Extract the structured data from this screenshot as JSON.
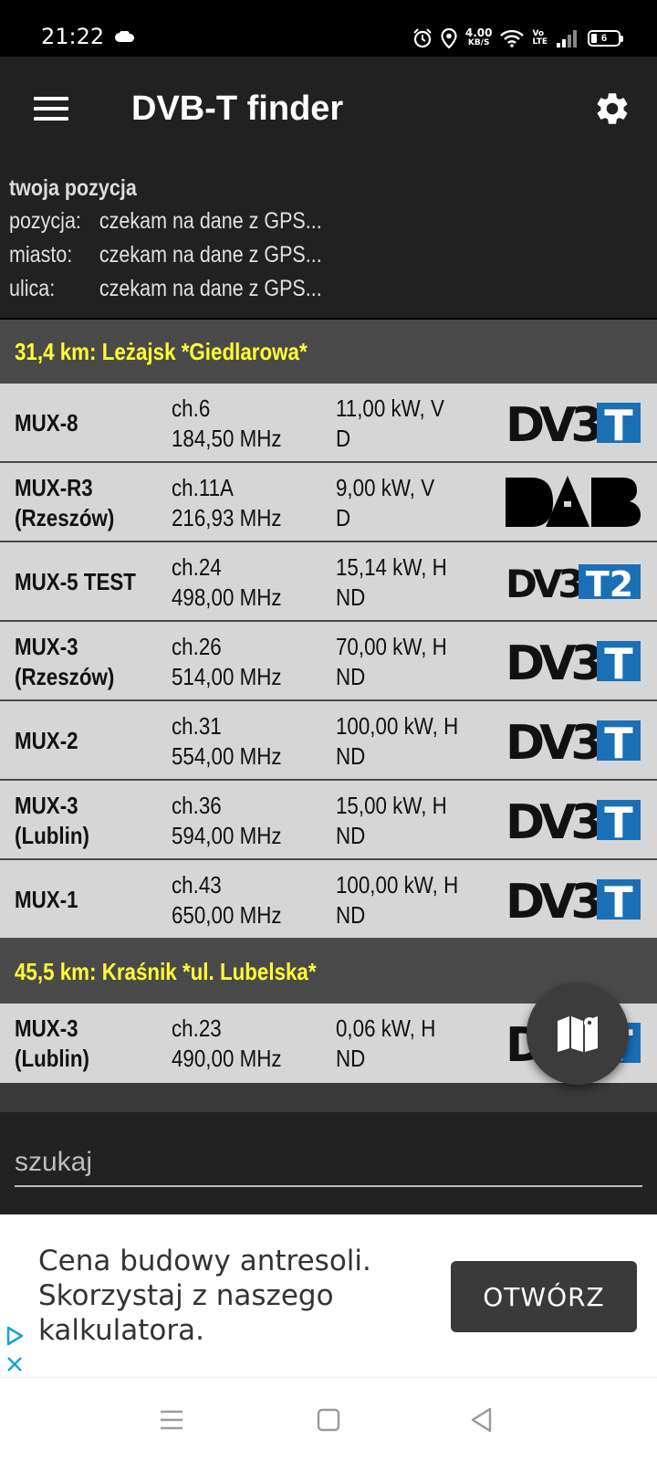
{
  "status_bar": {
    "time": "21:22",
    "speed_value": "4.00",
    "speed_unit": "KB/S",
    "volte_top": "Vo",
    "volte_bottom": "LTE",
    "battery": "6"
  },
  "app": {
    "title": "DVB-T finder"
  },
  "position": {
    "heading": "twoja pozycja",
    "rows": [
      {
        "label": "pozycja:",
        "value": "czekam na dane z GPS..."
      },
      {
        "label": "miasto:",
        "value": "czekam na dane z GPS..."
      },
      {
        "label": "ulica:",
        "value": "czekam na dane z GPS..."
      }
    ]
  },
  "transmitters": [
    {
      "header": "31,4 km: Leżajsk *Giedlarowa*",
      "muxes": [
        {
          "name": [
            "MUX-8",
            ""
          ],
          "channel": "ch.6",
          "freq": "184,50 MHz",
          "power": "11,00 kW, V",
          "pol": "D",
          "logo": "DVB-T"
        },
        {
          "name": [
            "MUX-R3",
            "(Rzeszów)"
          ],
          "channel": "ch.11A",
          "freq": "216,93 MHz",
          "power": "9,00 kW, V",
          "pol": "D",
          "logo": "DAB"
        },
        {
          "name": [
            "MUX-5 TEST",
            ""
          ],
          "channel": "ch.24",
          "freq": "498,00 MHz",
          "power": "15,14 kW, H",
          "pol": "ND",
          "logo": "DVB-T2"
        },
        {
          "name": [
            "MUX-3",
            "(Rzeszów)"
          ],
          "channel": "ch.26",
          "freq": "514,00 MHz",
          "power": "70,00 kW, H",
          "pol": "ND",
          "logo": "DVB-T"
        },
        {
          "name": [
            "MUX-2",
            ""
          ],
          "channel": "ch.31",
          "freq": "554,00 MHz",
          "power": "100,00 kW, H",
          "pol": "ND",
          "logo": "DVB-T"
        },
        {
          "name": [
            "MUX-3",
            "(Lublin)"
          ],
          "channel": "ch.36",
          "freq": "594,00 MHz",
          "power": "15,00 kW, H",
          "pol": "ND",
          "logo": "DVB-T"
        },
        {
          "name": [
            "MUX-1",
            ""
          ],
          "channel": "ch.43",
          "freq": "650,00 MHz",
          "power": "100,00 kW, H",
          "pol": "ND",
          "logo": "DVB-T"
        }
      ]
    },
    {
      "header": "45,5 km: Kraśnik *ul. Lubelska*",
      "muxes": [
        {
          "name": [
            "MUX-3",
            "(Lublin)"
          ],
          "channel": "ch.23",
          "freq": "490,00 MHz",
          "power": "0,06 kW, H",
          "pol": "ND",
          "logo": "DVB-T"
        }
      ]
    }
  ],
  "search": {
    "placeholder": "szukaj"
  },
  "ad": {
    "text": "Cena budowy antresoli. Skorzystaj z naszego kalkulatora.",
    "button": "OTWÓRZ"
  },
  "icons": {
    "menu": "hamburger-icon",
    "settings": "gear-icon",
    "map": "map-icon",
    "nav": [
      "recents-icon",
      "home-icon",
      "back-icon"
    ]
  },
  "colors": {
    "header_text": "#ffff33",
    "dvb_blue": "#1a6fb5",
    "row_bg": "#d6d6d6"
  }
}
